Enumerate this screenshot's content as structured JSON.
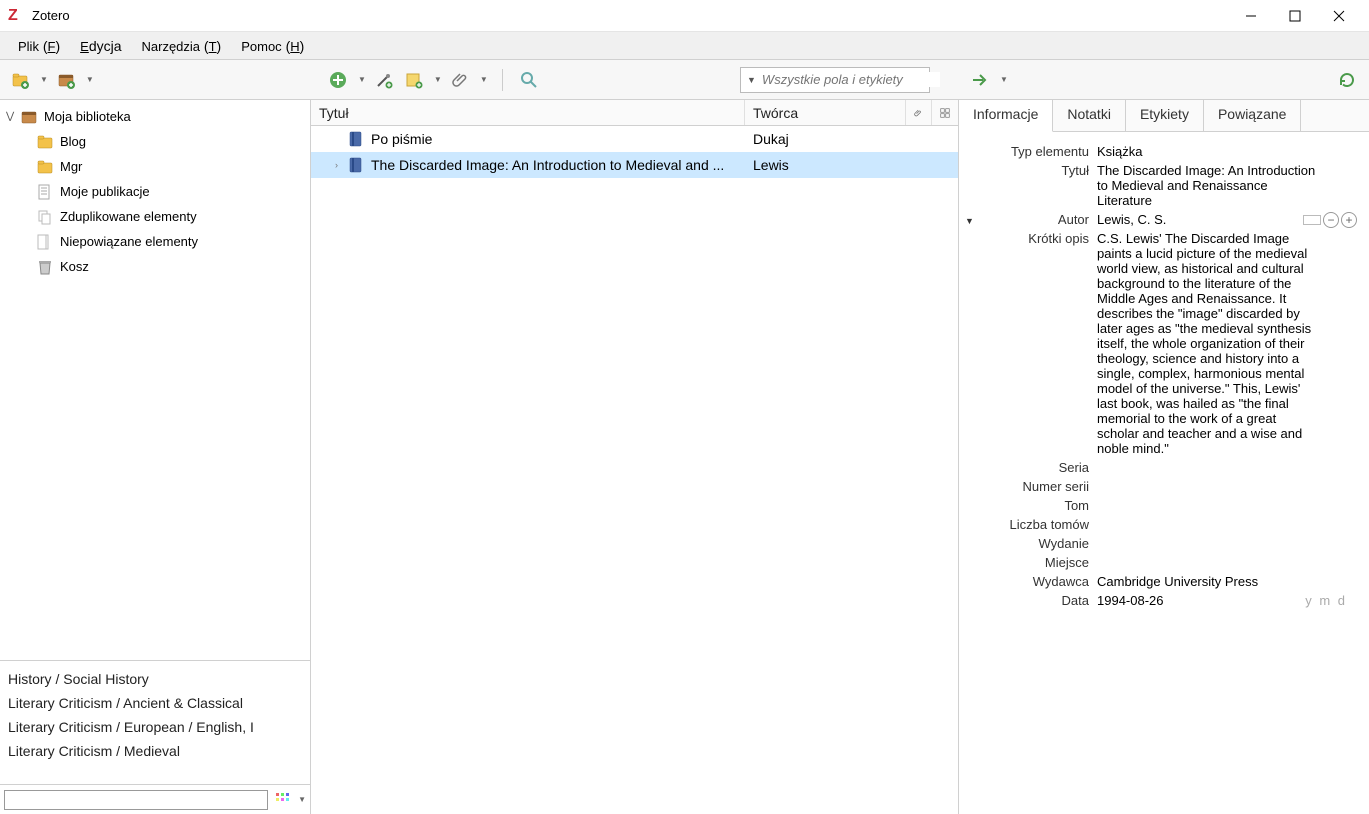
{
  "titlebar": {
    "title": "Zotero"
  },
  "menubar": {
    "file": "Plik",
    "file_accel": "F",
    "edit": "Edycja",
    "tools": "Narzędzia",
    "tools_accel": "T",
    "help": "Pomoc",
    "help_accel": "H"
  },
  "toolbar": {
    "search_placeholder": "Wszystkie pola i etykiety"
  },
  "sidebar": {
    "library": "Moja biblioteka",
    "items": [
      {
        "label": "Blog",
        "icon": "folder"
      },
      {
        "label": "Mgr",
        "icon": "folder"
      },
      {
        "label": "Moje publikacje",
        "icon": "doc"
      },
      {
        "label": "Zduplikowane elementy",
        "icon": "dup"
      },
      {
        "label": "Niepowiązane elementy",
        "icon": "unfiled"
      },
      {
        "label": "Kosz",
        "icon": "trash"
      }
    ]
  },
  "tags": [
    "History / Social History",
    "Literary Criticism / Ancient & Classical",
    "Literary Criticism / European / English, I",
    "Literary Criticism / Medieval"
  ],
  "list": {
    "headers": {
      "title": "Tytuł",
      "creator": "Twórca"
    },
    "rows": [
      {
        "title": "Po piśmie",
        "creator": "Dukaj",
        "selected": false,
        "expandable": false
      },
      {
        "title": "The Discarded Image: An Introduction to Medieval and ...",
        "creator": "Lewis",
        "selected": true,
        "expandable": true
      }
    ]
  },
  "details": {
    "tabs": [
      "Informacje",
      "Notatki",
      "Etykiety",
      "Powiązane"
    ],
    "active_tab": 0,
    "fields": {
      "type_label": "Typ elementu",
      "type_value": "Książka",
      "title_label": "Tytuł",
      "title_value": "The Discarded Image: An Introduction to Medieval and Renaissance Literature",
      "author_label": "Autor",
      "author_value": "Lewis, C. S.",
      "abstract_label": "Krótki opis",
      "abstract_value": "C.S. Lewis' The Discarded Image paints a lucid picture of the medieval world view, as historical and cultural background to the literature of the Middle Ages and Renaissance. It describes the \"image\" discarded by later ages as \"the medieval synthesis itself, the whole organization of their theology, science and history into a single, complex, harmonious mental model of the universe.\" This, Lewis' last book, was hailed as \"the final memorial to the work of a great scholar and teacher and a wise and noble mind.\"",
      "series_label": "Seria",
      "series_value": "",
      "series_num_label": "Numer serii",
      "series_num_value": "",
      "volume_label": "Tom",
      "volume_value": "",
      "num_volumes_label": "Liczba tomów",
      "num_volumes_value": "",
      "edition_label": "Wydanie",
      "edition_value": "",
      "place_label": "Miejsce",
      "place_value": "",
      "publisher_label": "Wydawca",
      "publisher_value": "Cambridge University Press",
      "date_label": "Data",
      "date_value": "1994-08-26",
      "date_hint": "y m d"
    }
  }
}
